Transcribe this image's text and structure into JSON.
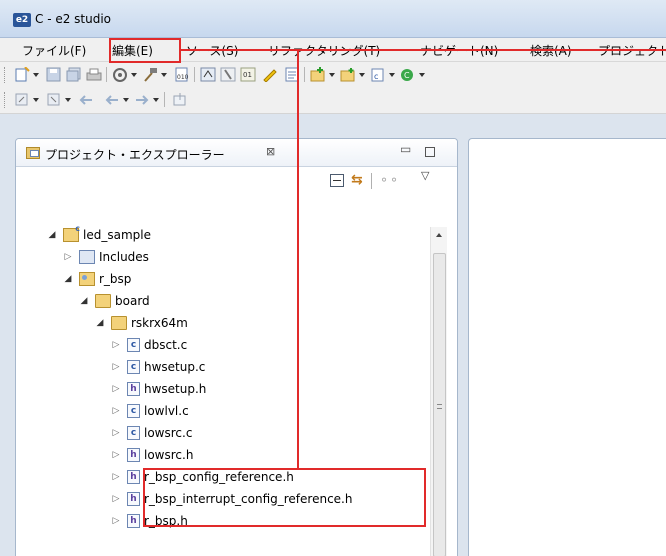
{
  "window": {
    "app_icon_text": "e2",
    "title": "C - e2 studio"
  },
  "menu": {
    "items": [
      "ファイル(F)",
      "編集(E)",
      "ソース(S)",
      "リファクタリング(T)",
      "ナビゲート(N)",
      "検索(A)",
      "プロジェクト"
    ]
  },
  "explorer": {
    "title": "プロジェクト・エクスプローラー",
    "close_glyph": "⊠",
    "min_glyph": "▭",
    "link_glyph": "⇆",
    "filter_glyph": "⚬⚬",
    "menu_glyph": "▽",
    "tree": [
      {
        "label": "led_sample",
        "expander": "◢",
        "icon": "project-folder-icon"
      },
      {
        "label": "Includes",
        "expander": "▷",
        "icon": "includes-icon"
      },
      {
        "label": "r_bsp",
        "expander": "◢",
        "icon": "source-folder-icon"
      },
      {
        "label": "board",
        "expander": "◢",
        "icon": "folder-icon"
      },
      {
        "label": "rskrx64m",
        "expander": "◢",
        "icon": "folder-icon"
      },
      {
        "label": "dbsct.c",
        "expander": "▷",
        "icon": "c-file-icon",
        "icon_text": "c"
      },
      {
        "label": "hwsetup.c",
        "expander": "▷",
        "icon": "c-file-icon",
        "icon_text": "c"
      },
      {
        "label": "hwsetup.h",
        "expander": "▷",
        "icon": "h-file-icon",
        "icon_text": "h"
      },
      {
        "label": "lowlvl.c",
        "expander": "▷",
        "icon": "c-file-icon",
        "icon_text": "c"
      },
      {
        "label": "lowsrc.c",
        "expander": "▷",
        "icon": "c-file-icon",
        "icon_text": "c"
      },
      {
        "label": "lowsrc.h",
        "expander": "▷",
        "icon": "h-file-icon",
        "icon_text": "h"
      },
      {
        "label": "r_bsp_config_reference.h",
        "expander": "▷",
        "icon": "h-file-icon",
        "icon_text": "h"
      },
      {
        "label": "r_bsp_interrupt_config_reference.h",
        "expander": "▷",
        "icon": "h-file-icon",
        "icon_text": "h"
      },
      {
        "label": "r_bsp.h",
        "expander": "▷",
        "icon": "h-file-icon",
        "icon_text": "h"
      }
    ]
  },
  "colors": {
    "highlight": "#e12a2a",
    "workbench": "#dce4ee"
  }
}
